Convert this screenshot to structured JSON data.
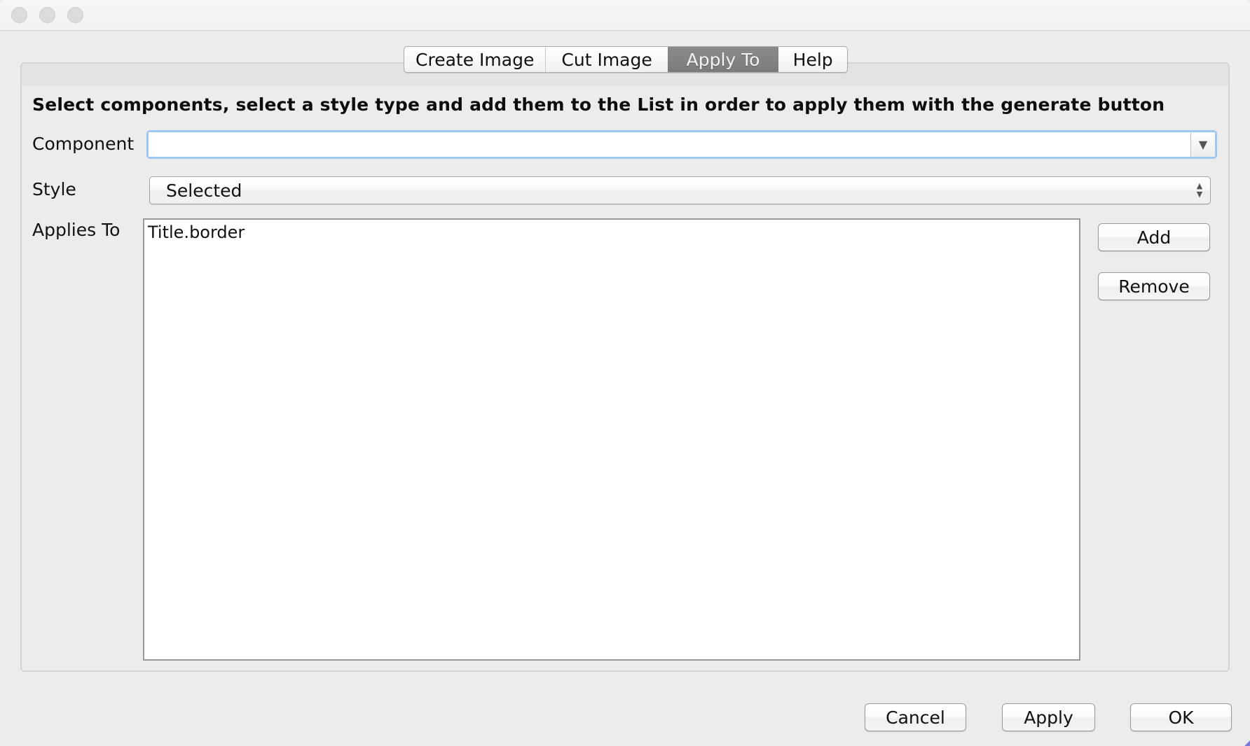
{
  "window": {
    "controls": [
      "close",
      "minimize",
      "zoom"
    ]
  },
  "tabs": [
    {
      "label": "Create Image",
      "active": false
    },
    {
      "label": "Cut Image",
      "active": false
    },
    {
      "label": "Apply To",
      "active": true
    },
    {
      "label": "Help",
      "active": false
    }
  ],
  "panel": {
    "instructions": "Select components, select a style type and add them to the List in order to apply them with the generate button",
    "component": {
      "label": "Component",
      "value": "",
      "dropdown_icon": "triangle-down"
    },
    "style": {
      "label": "Style",
      "selected": "Selected",
      "arrows_icon": "up-down-arrows"
    },
    "applies_to": {
      "label": "Applies To",
      "items": [
        "Title.border"
      ]
    },
    "add_label": "Add",
    "remove_label": "Remove"
  },
  "footer": {
    "cancel_label": "Cancel",
    "apply_label": "Apply",
    "ok_label": "OK"
  },
  "colors": {
    "active_tab": "#808080",
    "focus_ring": "#9cc8f2",
    "background": "#ececec"
  }
}
